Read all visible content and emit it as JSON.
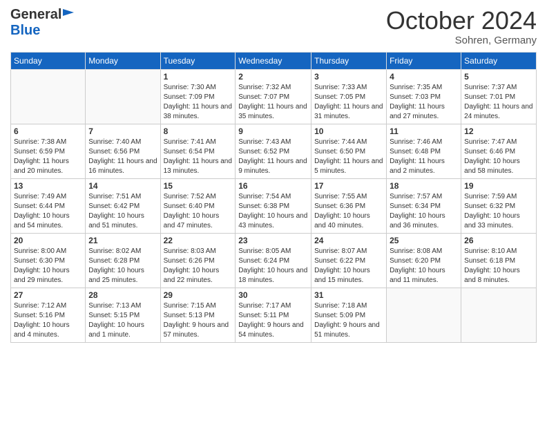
{
  "header": {
    "logo_line1": "General",
    "logo_line2": "Blue",
    "month": "October 2024",
    "location": "Sohren, Germany"
  },
  "days_of_week": [
    "Sunday",
    "Monday",
    "Tuesday",
    "Wednesday",
    "Thursday",
    "Friday",
    "Saturday"
  ],
  "weeks": [
    [
      {
        "day": "",
        "info": ""
      },
      {
        "day": "",
        "info": ""
      },
      {
        "day": "1",
        "info": "Sunrise: 7:30 AM\nSunset: 7:09 PM\nDaylight: 11 hours and 38 minutes."
      },
      {
        "day": "2",
        "info": "Sunrise: 7:32 AM\nSunset: 7:07 PM\nDaylight: 11 hours and 35 minutes."
      },
      {
        "day": "3",
        "info": "Sunrise: 7:33 AM\nSunset: 7:05 PM\nDaylight: 11 hours and 31 minutes."
      },
      {
        "day": "4",
        "info": "Sunrise: 7:35 AM\nSunset: 7:03 PM\nDaylight: 11 hours and 27 minutes."
      },
      {
        "day": "5",
        "info": "Sunrise: 7:37 AM\nSunset: 7:01 PM\nDaylight: 11 hours and 24 minutes."
      }
    ],
    [
      {
        "day": "6",
        "info": "Sunrise: 7:38 AM\nSunset: 6:59 PM\nDaylight: 11 hours and 20 minutes."
      },
      {
        "day": "7",
        "info": "Sunrise: 7:40 AM\nSunset: 6:56 PM\nDaylight: 11 hours and 16 minutes."
      },
      {
        "day": "8",
        "info": "Sunrise: 7:41 AM\nSunset: 6:54 PM\nDaylight: 11 hours and 13 minutes."
      },
      {
        "day": "9",
        "info": "Sunrise: 7:43 AM\nSunset: 6:52 PM\nDaylight: 11 hours and 9 minutes."
      },
      {
        "day": "10",
        "info": "Sunrise: 7:44 AM\nSunset: 6:50 PM\nDaylight: 11 hours and 5 minutes."
      },
      {
        "day": "11",
        "info": "Sunrise: 7:46 AM\nSunset: 6:48 PM\nDaylight: 11 hours and 2 minutes."
      },
      {
        "day": "12",
        "info": "Sunrise: 7:47 AM\nSunset: 6:46 PM\nDaylight: 10 hours and 58 minutes."
      }
    ],
    [
      {
        "day": "13",
        "info": "Sunrise: 7:49 AM\nSunset: 6:44 PM\nDaylight: 10 hours and 54 minutes."
      },
      {
        "day": "14",
        "info": "Sunrise: 7:51 AM\nSunset: 6:42 PM\nDaylight: 10 hours and 51 minutes."
      },
      {
        "day": "15",
        "info": "Sunrise: 7:52 AM\nSunset: 6:40 PM\nDaylight: 10 hours and 47 minutes."
      },
      {
        "day": "16",
        "info": "Sunrise: 7:54 AM\nSunset: 6:38 PM\nDaylight: 10 hours and 43 minutes."
      },
      {
        "day": "17",
        "info": "Sunrise: 7:55 AM\nSunset: 6:36 PM\nDaylight: 10 hours and 40 minutes."
      },
      {
        "day": "18",
        "info": "Sunrise: 7:57 AM\nSunset: 6:34 PM\nDaylight: 10 hours and 36 minutes."
      },
      {
        "day": "19",
        "info": "Sunrise: 7:59 AM\nSunset: 6:32 PM\nDaylight: 10 hours and 33 minutes."
      }
    ],
    [
      {
        "day": "20",
        "info": "Sunrise: 8:00 AM\nSunset: 6:30 PM\nDaylight: 10 hours and 29 minutes."
      },
      {
        "day": "21",
        "info": "Sunrise: 8:02 AM\nSunset: 6:28 PM\nDaylight: 10 hours and 25 minutes."
      },
      {
        "day": "22",
        "info": "Sunrise: 8:03 AM\nSunset: 6:26 PM\nDaylight: 10 hours and 22 minutes."
      },
      {
        "day": "23",
        "info": "Sunrise: 8:05 AM\nSunset: 6:24 PM\nDaylight: 10 hours and 18 minutes."
      },
      {
        "day": "24",
        "info": "Sunrise: 8:07 AM\nSunset: 6:22 PM\nDaylight: 10 hours and 15 minutes."
      },
      {
        "day": "25",
        "info": "Sunrise: 8:08 AM\nSunset: 6:20 PM\nDaylight: 10 hours and 11 minutes."
      },
      {
        "day": "26",
        "info": "Sunrise: 8:10 AM\nSunset: 6:18 PM\nDaylight: 10 hours and 8 minutes."
      }
    ],
    [
      {
        "day": "27",
        "info": "Sunrise: 7:12 AM\nSunset: 5:16 PM\nDaylight: 10 hours and 4 minutes."
      },
      {
        "day": "28",
        "info": "Sunrise: 7:13 AM\nSunset: 5:15 PM\nDaylight: 10 hours and 1 minute."
      },
      {
        "day": "29",
        "info": "Sunrise: 7:15 AM\nSunset: 5:13 PM\nDaylight: 9 hours and 57 minutes."
      },
      {
        "day": "30",
        "info": "Sunrise: 7:17 AM\nSunset: 5:11 PM\nDaylight: 9 hours and 54 minutes."
      },
      {
        "day": "31",
        "info": "Sunrise: 7:18 AM\nSunset: 5:09 PM\nDaylight: 9 hours and 51 minutes."
      },
      {
        "day": "",
        "info": ""
      },
      {
        "day": "",
        "info": ""
      }
    ]
  ]
}
